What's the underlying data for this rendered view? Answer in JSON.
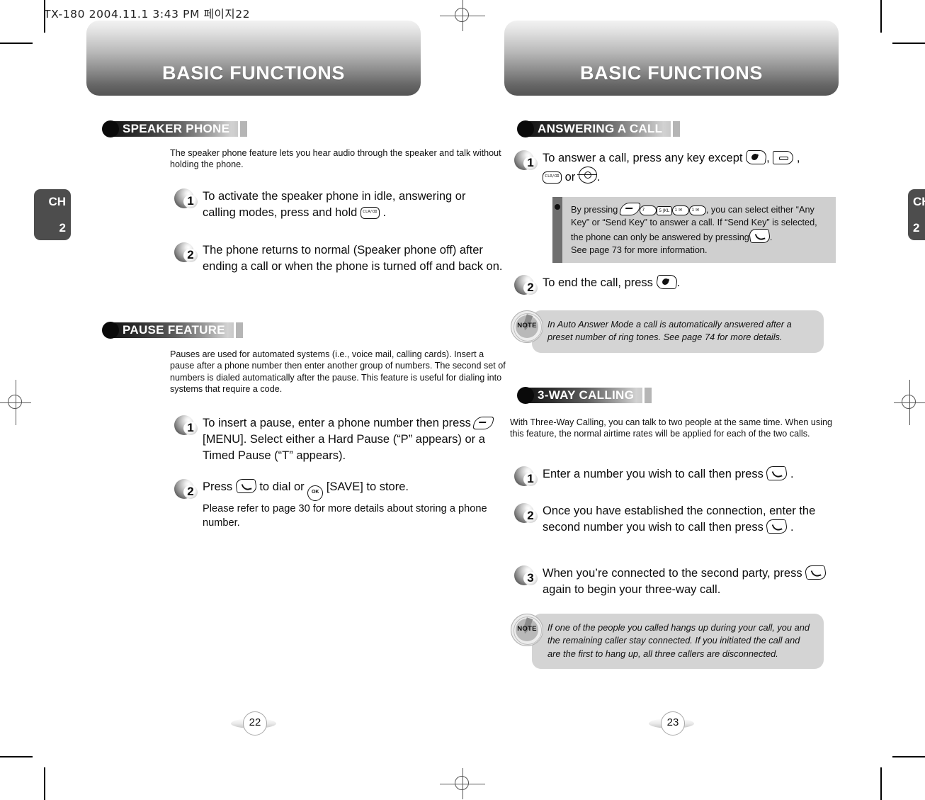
{
  "file_stamp": "TX-180  2004.11.1 3:43 PM  페이지22",
  "pages": [
    {
      "id": "page-22",
      "banner_title": "BASIC FUNCTIONS",
      "chapter_tab": {
        "label": "CH",
        "number": "2"
      },
      "page_number": "22",
      "sections": [
        {
          "heading": "SPEAKER PHONE",
          "intro": "The speaker phone feature lets you hear audio through the speaker and talk without holding the phone.",
          "steps": [
            {
              "number": "1",
              "text_before": "To activate the speaker phone in idle, answering or calling modes, press and hold ",
              "icons": [
                "clr-key-icon"
              ],
              "text_after": " ."
            },
            {
              "number": "2",
              "text_before": "The phone returns to normal (Speaker phone off) after ending a call or when the phone is turned off and back on.",
              "icons": [],
              "text_after": ""
            }
          ]
        },
        {
          "heading": "PAUSE FEATURE",
          "intro": "Pauses are used for automated systems (i.e., voice mail, calling cards). Insert a pause after a phone number then enter another group of numbers. The second set of numbers is dialed automatically after the pause. This feature is useful for dialing into systems that require a code.",
          "steps": [
            {
              "number": "1",
              "text_before": "To insert a pause, enter a phone number then press ",
              "icons": [
                "menu-key-icon"
              ],
              "text_after": " [MENU]. Select either a Hard Pause (“P” appears) or a Timed Pause (“T” appears)."
            },
            {
              "number": "2",
              "text_before": "Press ",
              "icons": [
                "send-key-icon",
                "ok-key-icon"
              ],
              "text_mid": " to dial or ",
              "text_after": " [SAVE] to store.",
              "subtext": "Please refer to page 30 for more details about storing a phone number."
            }
          ]
        }
      ]
    },
    {
      "id": "page-23",
      "banner_title": "BASIC FUNCTIONS",
      "chapter_tab": {
        "label": "CH",
        "number": "2"
      },
      "page_number": "23",
      "sections": [
        {
          "heading": "ANSWERING A CALL",
          "steps": [
            {
              "number": "1",
              "text_before": "To answer a call, press any key except ",
              "icons": [
                "end-key-icon",
                "soft-key-icon",
                "clr-key-icon",
                "nav-key-icon"
              ],
              "text_mid": ", ",
              "text_after": " or "
            },
            {
              "number": "2",
              "text_before": "To end the call, press ",
              "icons": [
                "end-key-icon"
              ],
              "text_after": "."
            }
          ],
          "info_box": {
            "line1_before": "By pressing ",
            "key_labels": [
              "menu-key-icon",
              "7 PQRS",
              "5 JKL",
              "1 ✉",
              "1 ✉"
            ],
            "line1_after": ", you can select either “Any Key” or “Send Key” to answer a call. If “Send Key” is selected, the phone can only be answered by pressing",
            "line2": ".",
            "line3": "See page 73 for more information."
          },
          "note": "In Auto Answer Mode a call is automatically answered after a preset number of ring tones. See page 74 for more details."
        },
        {
          "heading": "3-WAY CALLING",
          "intro": "With Three-Way Calling, you can talk to two people at the same time. When using this feature, the normal airtime rates will be applied for each of the two calls.",
          "steps": [
            {
              "number": "1",
              "text_before": "Enter a number you wish to call then press ",
              "icons": [
                "send-key-icon"
              ],
              "text_after": " ."
            },
            {
              "number": "2",
              "text_before": "Once you have established the connection, enter the second number you wish to call then press ",
              "icons": [
                "send-key-icon"
              ],
              "text_after": " ."
            },
            {
              "number": "3",
              "text_before": "When you’re connected to the second party, press ",
              "icons": [
                "send-key-icon"
              ],
              "text_after": " again to begin your three-way call."
            }
          ],
          "note": "If one of the people you called hangs up during your call, you and the remaining caller stay connected. If you initiated the call and are the first to hang up, all three callers are disconnected."
        }
      ]
    }
  ],
  "key_icon_labels": {
    "clr": "CLR/⌫",
    "ok": "OK",
    "num7": "7 PQRS",
    "num5": "5 JKL",
    "num1a": "1 ✉",
    "num1b": "1 ✉"
  }
}
